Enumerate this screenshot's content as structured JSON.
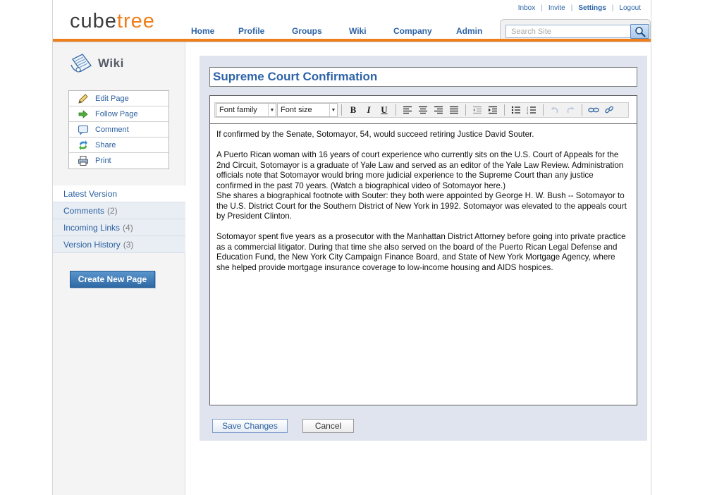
{
  "brand": {
    "part1": "cube",
    "part2": "tree"
  },
  "top_links": [
    {
      "label": "Inbox"
    },
    {
      "label": "Invite"
    },
    {
      "label": "Settings"
    },
    {
      "label": "Logout"
    }
  ],
  "nav": [
    "Home",
    "Profile",
    "Groups",
    "Wiki",
    "Company",
    "Admin"
  ],
  "search": {
    "placeholder": "Search Site"
  },
  "sidebar": {
    "section_title": "Wiki",
    "actions": [
      {
        "label": "Edit Page",
        "icon": "pencil-icon"
      },
      {
        "label": "Follow Page",
        "icon": "arrow-right-icon"
      },
      {
        "label": "Comment",
        "icon": "speech-bubble-icon"
      },
      {
        "label": "Share",
        "icon": "share-arrows-icon"
      },
      {
        "label": "Print",
        "icon": "printer-icon"
      }
    ],
    "tabs": [
      {
        "label": "Latest Version",
        "count": ""
      },
      {
        "label": "Comments",
        "count": "(2)"
      },
      {
        "label": "Incoming Links",
        "count": "(4)"
      },
      {
        "label": "Version History",
        "count": "(3)"
      }
    ],
    "create_button": "Create New Page"
  },
  "editor": {
    "title_value": "Supreme Court Confirmation",
    "font_family_label": "Font family",
    "font_size_label": "Font size",
    "paragraphs": [
      "If confirmed by the Senate, Sotomayor, 54, would succeed retiring Justice David Souter.",
      "A Puerto Rican woman with 16 years of court experience who currently sits on the U.S. Court of Appeals for the 2nd Circuit, Sotomayor is a graduate of Yale Law and served as an editor of the Yale Law Review. Administration officials note that Sotomayor would bring more judicial experience to the Supreme Court than any justice confirmed in the past 70 years. (Watch a biographical video of Sotomayor here.)",
      "She shares a biographical footnote with Souter: they both were appointed by George H. W. Bush -- Sotomayor to the U.S. District Court for the Southern District of New York in 1992. Sotomayor was elevated to the appeals court by President Clinton.",
      "Sotomayor spent five years as a prosecutor with the Manhattan District Attorney before going into private practice as a commercial litigator. During that time she also served on the board of the Puerto Rican Legal Defense and Education Fund, the New York City Campaign Finance Board, and State of New York Mortgage Agency, where she helped provide mortgage insurance coverage to low-income housing and AIDS hospices."
    ],
    "save_label": "Save Changes",
    "cancel_label": "Cancel"
  },
  "colors": {
    "accent": "#f07e1b",
    "link": "#2b5f9e",
    "panel": "#dfe4ee"
  }
}
